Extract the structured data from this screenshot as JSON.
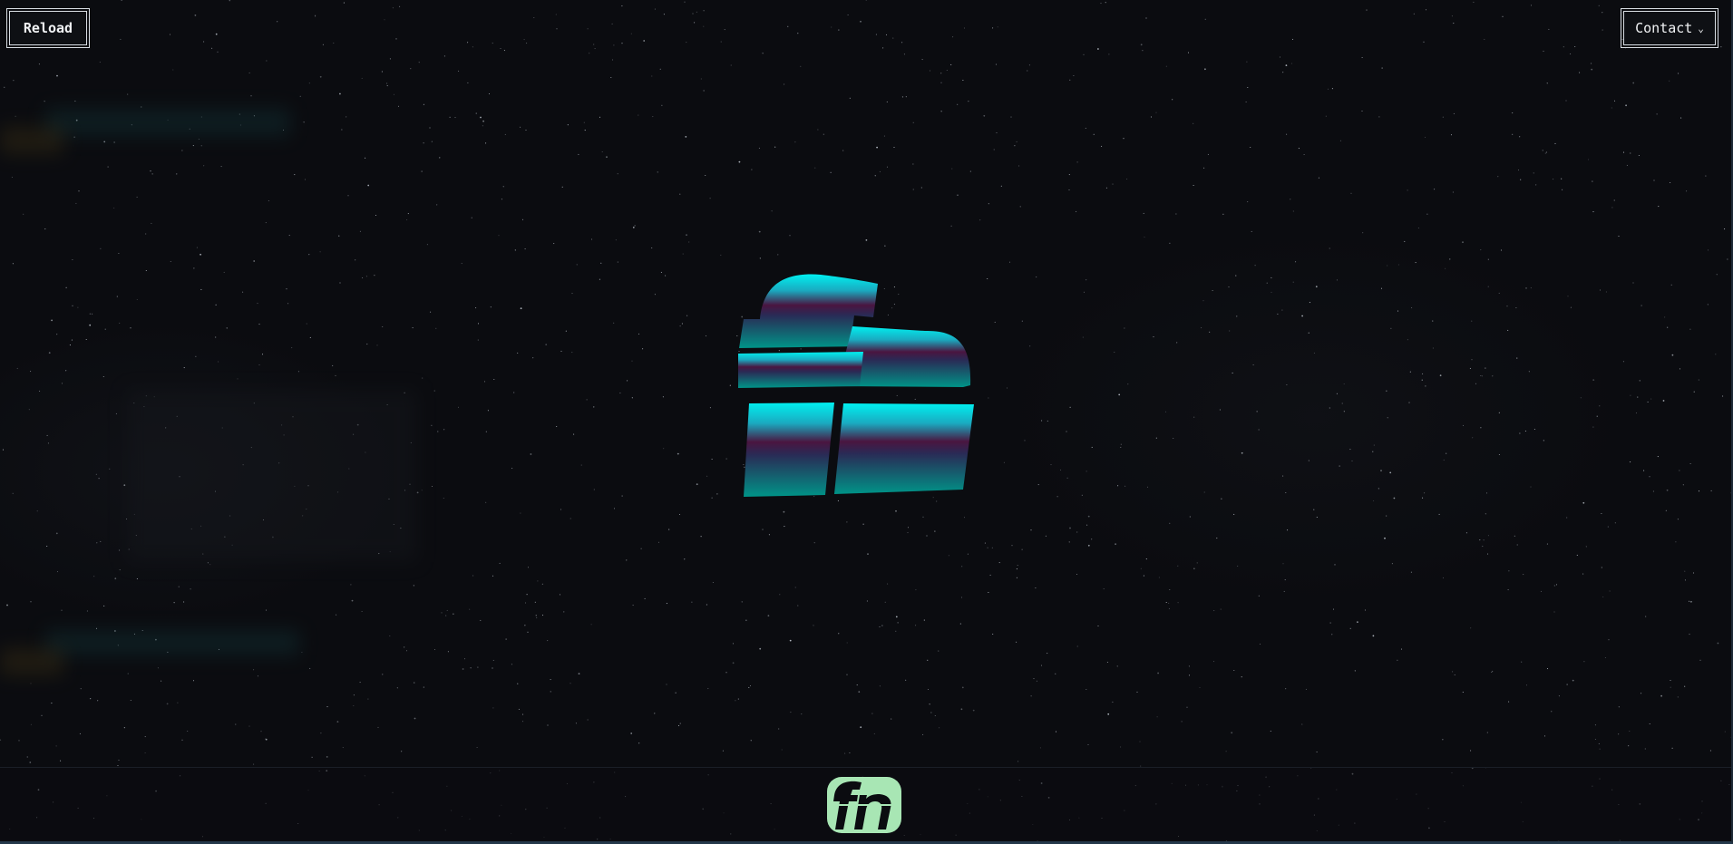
{
  "header": {
    "reload_label": "Reload",
    "contact_label": "Contact",
    "contact_chevron": "chevron-down-icon"
  },
  "hero": {
    "logo_icon": "fn-logo-icon"
  },
  "footer": {
    "logo_icon": "fn-logo-icon"
  },
  "colors": {
    "background": "#0b0c10",
    "logo_top": "#00e5ea",
    "logo_middle": "#4a1540",
    "logo_bottom": "#008f86",
    "footer_logo_bg": "#a8e6b4",
    "button_border": "#d8dde3"
  }
}
